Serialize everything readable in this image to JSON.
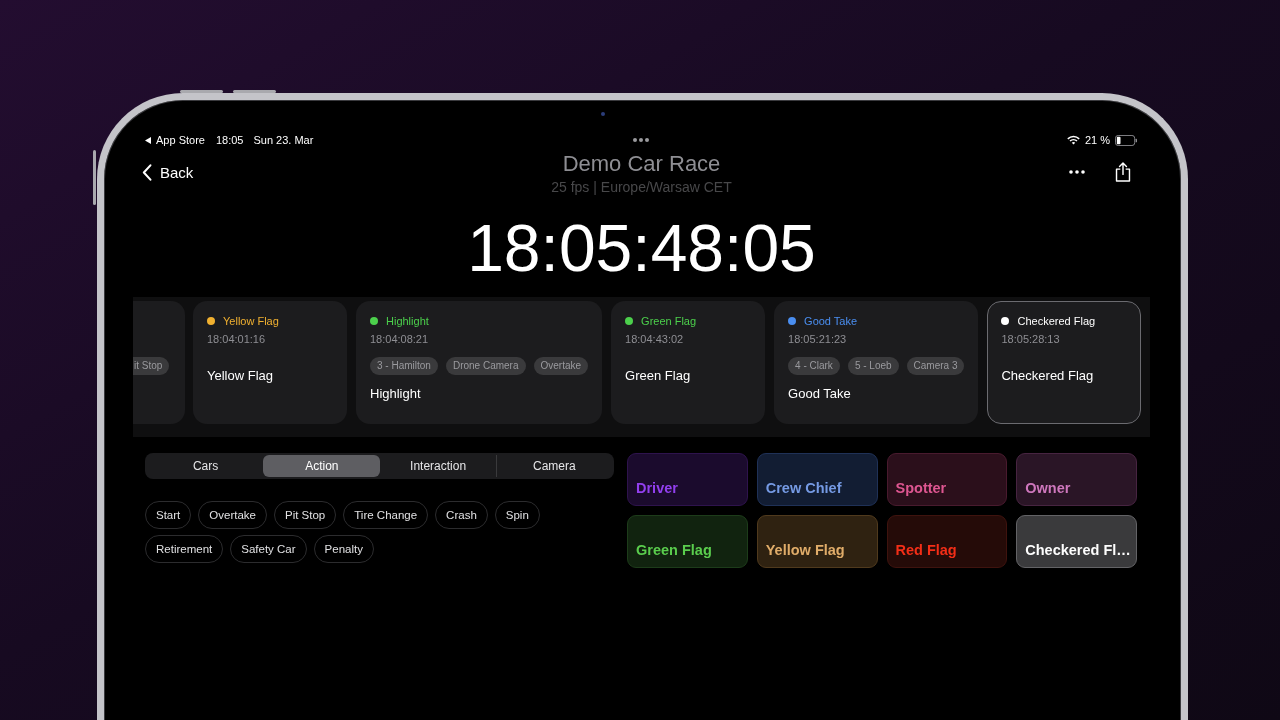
{
  "status_bar": {
    "back_app": "App Store",
    "time": "18:05",
    "date": "Sun 23. Mar",
    "battery": "21 %"
  },
  "nav": {
    "back": "Back",
    "title": "Demo Car Race",
    "subtitle": "25 fps | Europe/Warsaw CET"
  },
  "timecode": "18:05:48:05",
  "events": [
    {
      "kind": "cut_off",
      "tags": [
        "it Stop"
      ],
      "selected": false
    },
    {
      "kind": "card",
      "label": "Yellow Flag",
      "color": "#f0b030",
      "time": "18:04:01:16",
      "title": "Yellow Flag",
      "selected": false
    },
    {
      "kind": "card",
      "label": "Highlight",
      "color": "#4cd04c",
      "time": "18:04:08:21",
      "tags": [
        "3 - Hamilton",
        "Drone Camera",
        "Overtake"
      ],
      "title": "Highlight",
      "selected": false
    },
    {
      "kind": "card",
      "label": "Green Flag",
      "color": "#4cd04c",
      "time": "18:04:43:02",
      "title": "Green Flag",
      "selected": false
    },
    {
      "kind": "card",
      "label": "Good Take",
      "color": "#4a8ef0",
      "time": "18:05:21:23",
      "tags": [
        "4 - Clark",
        "5 - Loeb",
        "Camera 3"
      ],
      "title": "Good Take",
      "selected": false
    },
    {
      "kind": "card",
      "label": "Checkered Flag",
      "color": "#ffffff",
      "time": "18:05:28:13",
      "title": "Checkered Flag",
      "selected": true
    }
  ],
  "segments": [
    {
      "label": "Cars",
      "selected": false
    },
    {
      "label": "Action",
      "selected": true
    },
    {
      "label": "Interaction",
      "selected": false
    },
    {
      "label": "Camera",
      "selected": false
    }
  ],
  "actions": [
    "Start",
    "Overtake",
    "Pit Stop",
    "Tire Change",
    "Crash",
    "Spin",
    "Retirement",
    "Safety Car",
    "Penalty"
  ],
  "buttons": [
    {
      "label": "Driver",
      "color": "#1b0b2d"
    },
    {
      "label": "Crew Chief",
      "color": "#121d33"
    },
    {
      "label": "Spotter",
      "color": "#2b0f1b"
    },
    {
      "label": "Owner",
      "color": "#2a1526"
    },
    {
      "label": "Green Flag",
      "color": "#11230f"
    },
    {
      "label": "Yellow Flag",
      "color": "#2f2211"
    },
    {
      "label": "Red Flag",
      "color": "#250b08"
    },
    {
      "label": "Checkered Fl…",
      "color": "#3a3a3c"
    }
  ]
}
